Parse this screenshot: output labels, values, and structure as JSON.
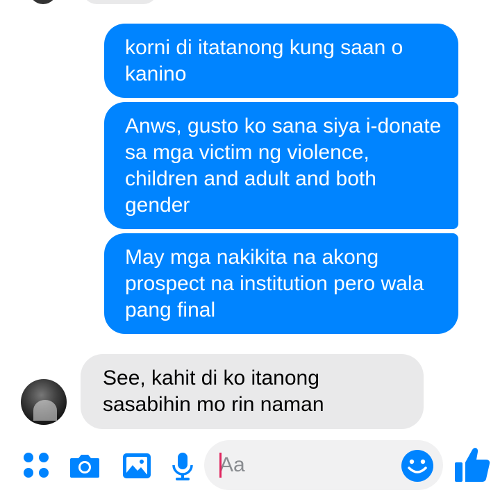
{
  "conversation": {
    "outgoing": [
      "korni di itatanong kung saan o kanino",
      "Anws, gusto ko sana siya i-donate sa mga victim ng violence, children and adult and both gender",
      "May mga nakikita na akong prospect na institution pero wala pang final"
    ],
    "incoming": [
      "See, kahit di ko itanong sasabihin mo rin naman"
    ]
  },
  "composer": {
    "placeholder": "Aa",
    "icons": [
      "grid-dots-icon",
      "camera-icon",
      "image-icon",
      "microphone-icon",
      "emoji-icon",
      "thumbs-up-icon"
    ]
  },
  "colors": {
    "outgoing_bubble": "#0084ff",
    "incoming_bubble": "#e9e9ea",
    "icon_accent": "#0084ff"
  }
}
